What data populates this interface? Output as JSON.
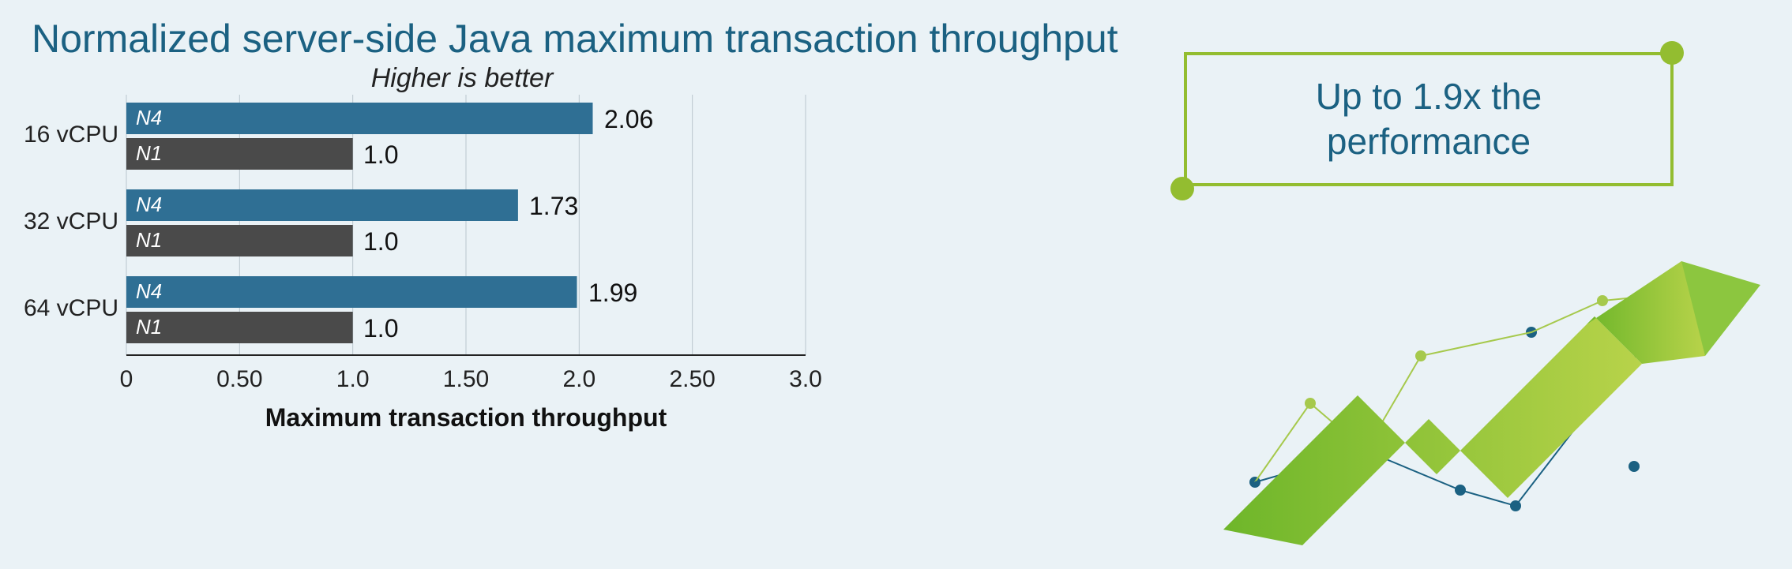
{
  "title": "Normalized server-side Java maximum transaction throughput",
  "subtitle": "Higher is better",
  "callout": "Up to 1.9x the performance",
  "chart_data": {
    "type": "bar",
    "orientation": "horizontal",
    "xlabel": "Maximum transaction throughput",
    "ylabel": "",
    "xlim": [
      0,
      3.0
    ],
    "xticks": [
      0,
      0.5,
      1.0,
      1.5,
      2.0,
      2.5,
      3.0
    ],
    "categories": [
      "16 vCPU",
      "32 vCPU",
      "64 vCPU"
    ],
    "series": [
      {
        "name": "N4",
        "color": "#2f6f94",
        "values": [
          2.06,
          1.73,
          1.99
        ]
      },
      {
        "name": "N1",
        "color": "#4a4a4a",
        "values": [
          1.0,
          1.0,
          1.0
        ]
      }
    ]
  }
}
